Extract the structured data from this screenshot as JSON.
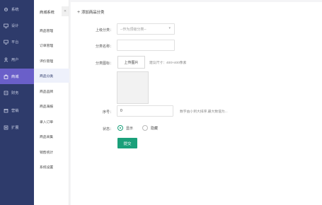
{
  "colors": {
    "sidebar": "#2e3b6b",
    "sidebar_active": "#6a5fc9",
    "accent_green": "#1aa07a"
  },
  "nav1": {
    "items": [
      {
        "icon": "gear-icon",
        "label": "系统"
      },
      {
        "icon": "monitor-icon",
        "label": "设计"
      },
      {
        "icon": "monitor-icon",
        "label": "平台"
      },
      {
        "icon": "user-icon",
        "label": "用户"
      },
      {
        "icon": "shop-icon",
        "label": "商城"
      },
      {
        "icon": "finance-icon",
        "label": "财务"
      },
      {
        "icon": "marketing-icon",
        "label": "营销"
      },
      {
        "icon": "extend-icon",
        "label": "扩展"
      }
    ],
    "active_index": 4
  },
  "nav2": {
    "title": "商城系统",
    "collapse_glyph": "«",
    "items": [
      "商品管理",
      "订单管理",
      "评价管理",
      "商品分类",
      "商品品牌",
      "商品海报",
      "录入订单",
      "商品采集",
      "销售统计",
      "系统设置"
    ],
    "active_index": 3
  },
  "form": {
    "title": "添加商品分类",
    "parent_label": "上级分类：",
    "parent_value": "--作为顶级分类--",
    "name_label": "分类名称：",
    "name_value": "",
    "icon_label": "分类图标：",
    "upload_label": "上传图片",
    "upload_hint": "建议尺寸：400×400像素",
    "sort_label": "序号：",
    "sort_value": "0",
    "sort_hint": "数字由小到大排序,最大数值为...",
    "status_label": "状态：",
    "status_options": [
      "显示",
      "隐藏"
    ],
    "status_selected": "显示",
    "submit_label": "提交"
  }
}
